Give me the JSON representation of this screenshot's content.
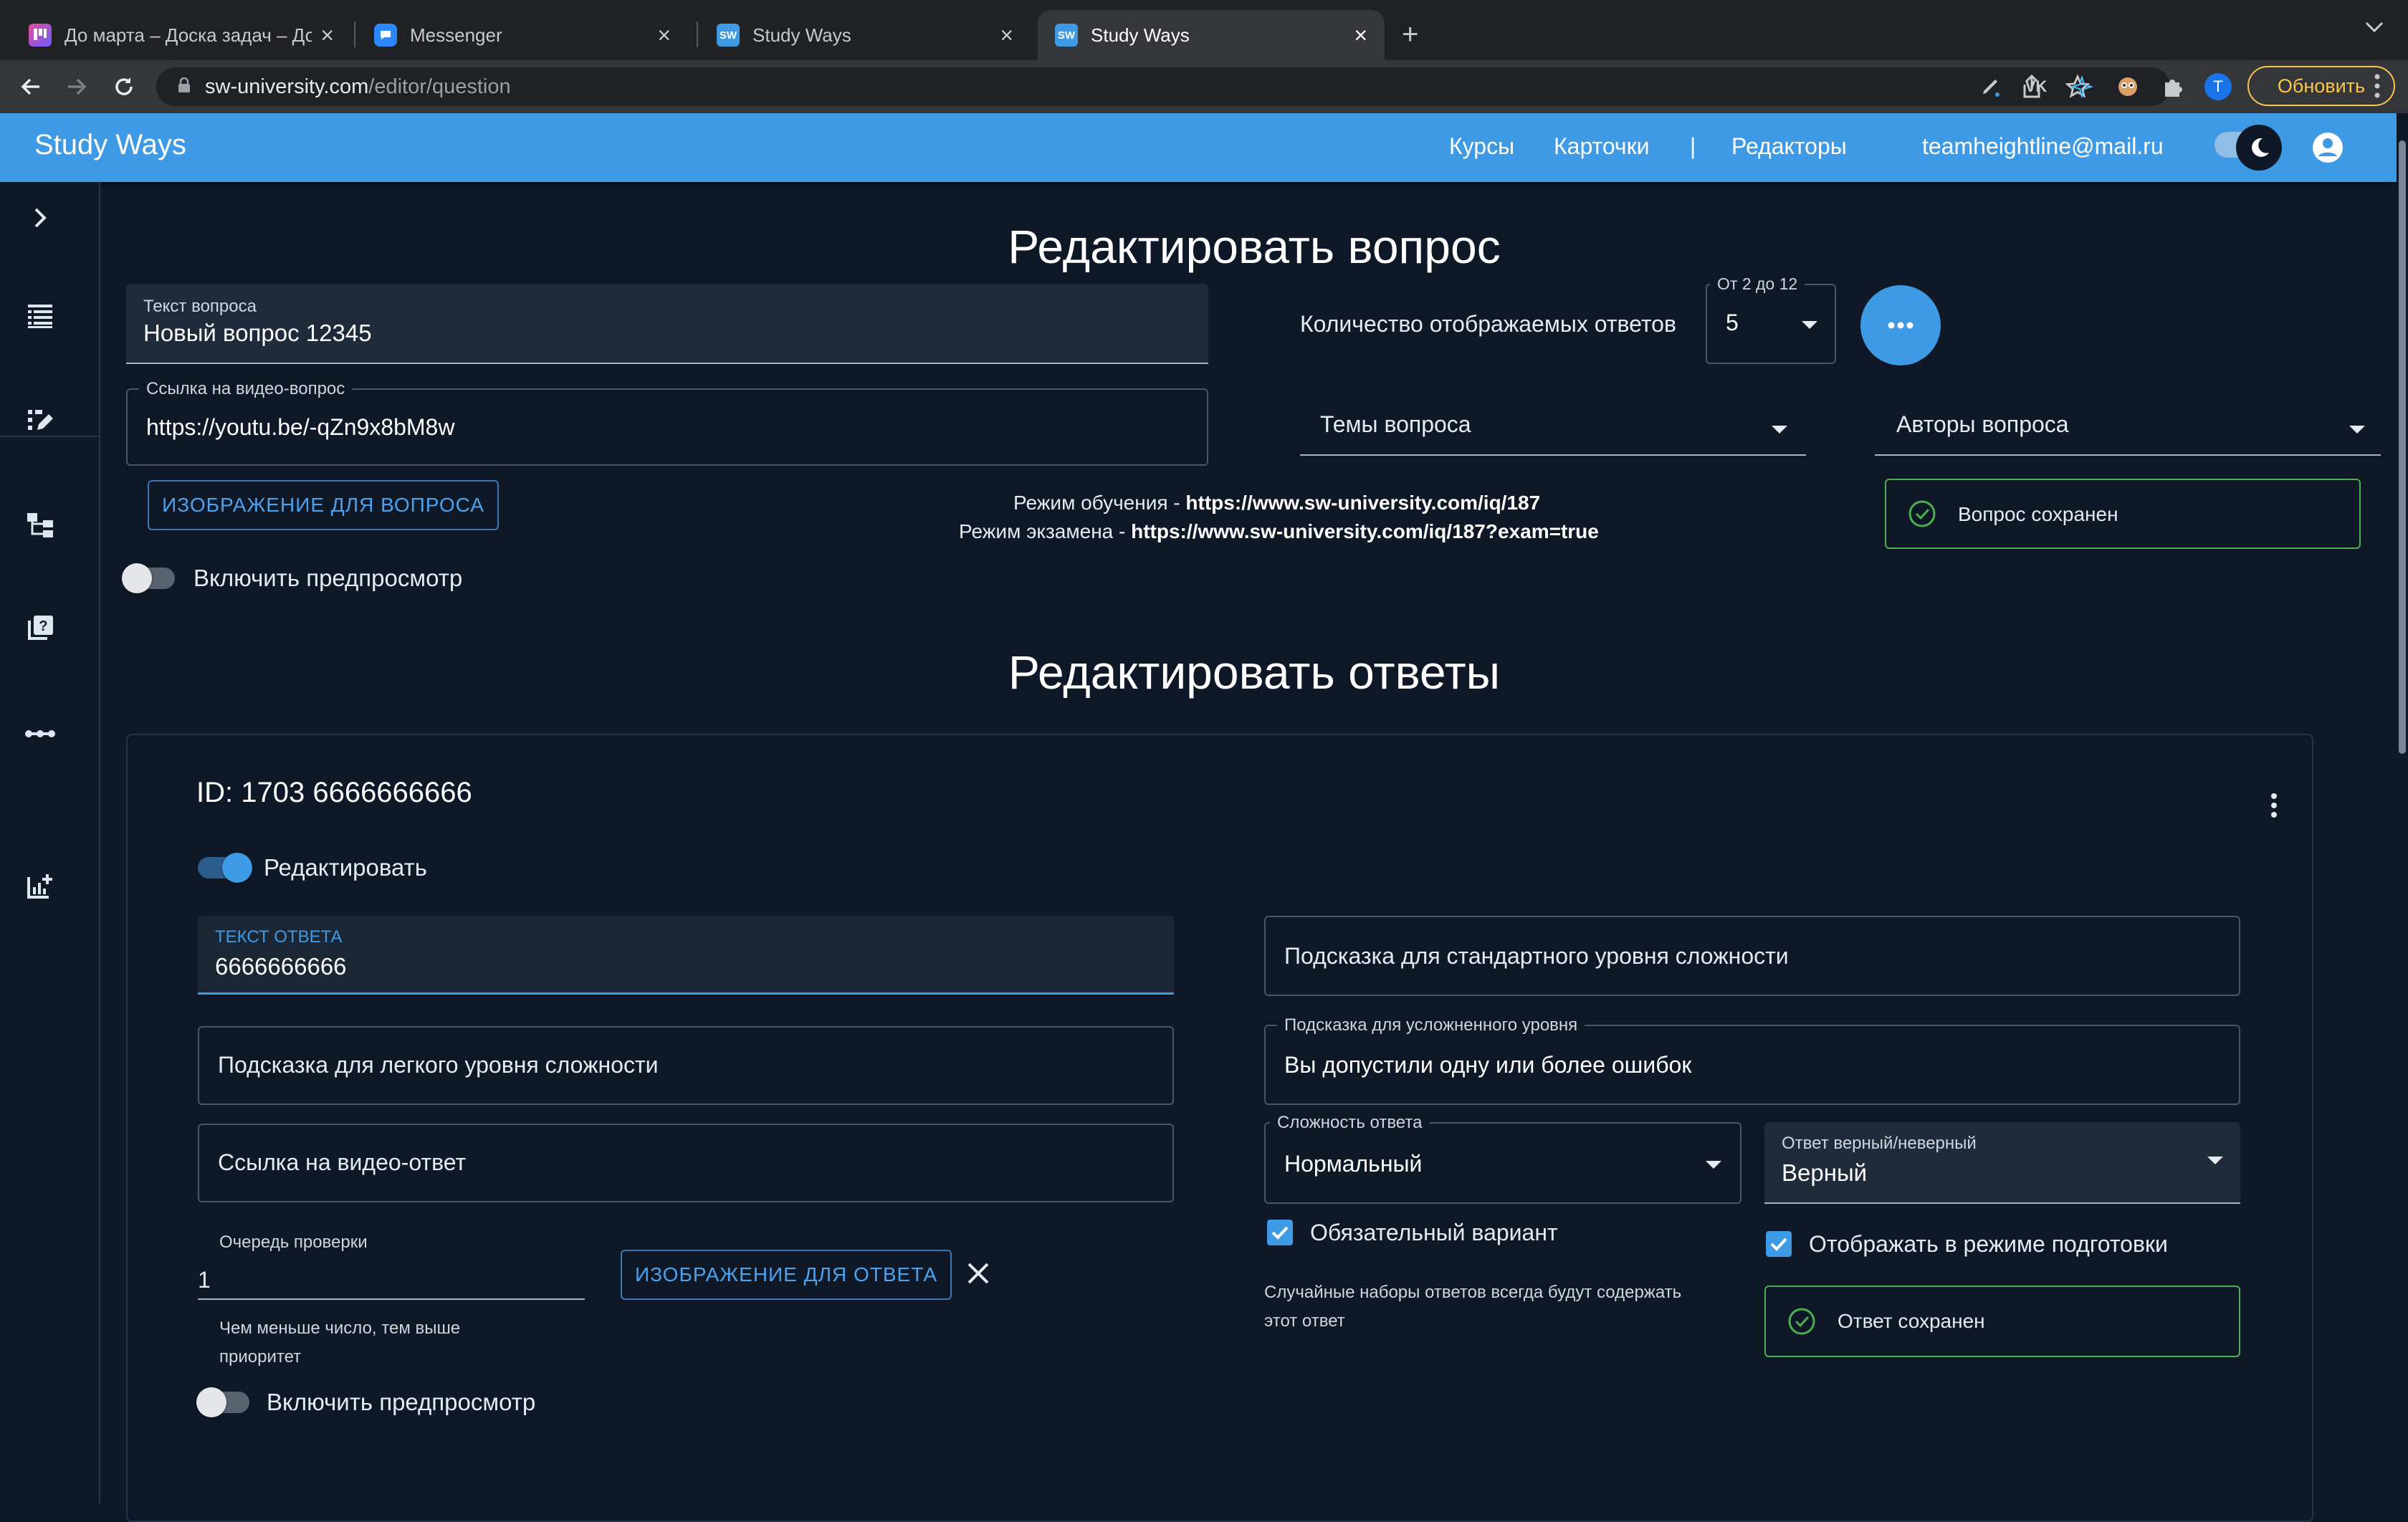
{
  "browser": {
    "tabs": [
      {
        "title": "До марта – Доска задач – До",
        "icon": "kanban-favicon-icon"
      },
      {
        "title": "Messenger",
        "icon": "messenger-favicon-icon"
      },
      {
        "title": "Study Ways",
        "icon": "sw-favicon-icon",
        "fav_text": "SW"
      },
      {
        "title": "Study Ways",
        "icon": "sw-favicon-icon",
        "fav_text": "SW",
        "active": true
      }
    ],
    "url_host": "sw-university.com",
    "url_path": "/editor/question",
    "update_label": "Обновить",
    "profile_initial": "T"
  },
  "header": {
    "brand": "Study Ways",
    "nav": {
      "courses": "Курсы",
      "cards": "Карточки",
      "separator": "|",
      "editors": "Редакторы"
    },
    "email": "teamheightline@mail.ru"
  },
  "question_editor": {
    "title": "Редактировать вопрос",
    "question_text_label": "Текст вопроса",
    "question_text_value": "Новый вопрос 12345",
    "video_link_label": "Ссылка на видео-вопрос",
    "video_link_value": "https://youtu.be/-qZn9x8bM8w",
    "image_button": "ИЗОБРАЖЕНИЕ ДЛЯ ВОПРОСА",
    "preview_label": "Включить предпросмотр",
    "answers_count_label": "Количество отображаемых ответов",
    "answers_count_hint": "От 2 до 12",
    "answers_count_value": "5",
    "topics_label": "Темы вопроса",
    "authors_label": "Авторы вопроса",
    "study_mode_prefix": "Режим обучения - ",
    "study_mode_url": "https://www.sw-university.com/iq/187",
    "exam_mode_prefix": "Режим экзамена - ",
    "exam_mode_url": "https://www.sw-university.com/iq/187?exam=true",
    "saved_message": "Вопрос сохранен"
  },
  "answers_editor": {
    "title": "Редактировать ответы",
    "answer": {
      "id_label": "ID: 1703 6666666666",
      "edit_toggle_label": "Редактировать",
      "answer_text_label": "ТЕКСТ ОТВЕТА",
      "answer_text_value": "6666666666",
      "hint_easy_placeholder": "Подсказка для легкого уровня сложности",
      "video_answer_placeholder": "Ссылка на видео-ответ",
      "queue_label": "Очередь проверки",
      "queue_value": "1",
      "queue_helper_line1": "Чем меньше число, тем выше",
      "queue_helper_line2": "приоритет",
      "image_button": "ИЗОБРАЖЕНИЕ ДЛЯ ОТВЕТА",
      "preview_label": "Включить предпросмотр",
      "hint_standard_placeholder": "Подсказка для стандартного уровня сложности",
      "hint_hard_label": "Подсказка для усложненного уровня",
      "hint_hard_value": "Вы допустили одну или более ошибок",
      "difficulty_label": "Сложность ответа",
      "difficulty_value": "Нормальный",
      "correctness_label": "Ответ верный/неверный",
      "correctness_value": "Верный",
      "required_label": "Обязательный вариант",
      "required_checked": true,
      "required_helper_line1": "Случайные наборы ответов всегда будут содержать",
      "required_helper_line2": "этот ответ",
      "show_in_prep_label": "Отображать в режиме подготовки",
      "show_in_prep_checked": true,
      "saved_message": "Ответ сохранен"
    }
  },
  "colors": {
    "accent": "#3e9ae5",
    "background": "#0e1827",
    "success": "#4caf50",
    "update_button": "#f8c64d"
  }
}
